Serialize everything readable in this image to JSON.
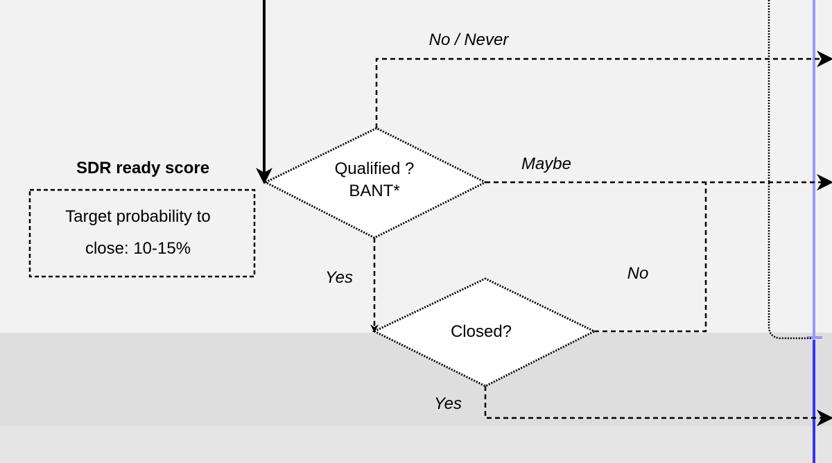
{
  "lanes": {
    "upper_color": "#f2f2f2",
    "middle_color": "#dedede",
    "lower_color": "#e5e5e5"
  },
  "boundary": {
    "upper_color": "#9999ff",
    "lower_color": "#3333ff"
  },
  "decision_qualified": {
    "line1": "Qualified ?",
    "line2": "BANT*"
  },
  "decision_closed": {
    "label": "Closed?"
  },
  "edges": {
    "no_never": "No / Never",
    "maybe": "Maybe",
    "yes_qualified": "Yes",
    "no_closed": "No",
    "yes_closed": "Yes"
  },
  "score": {
    "title": "SDR ready score",
    "line1": "Target probability to",
    "line2": "close: 10-15%"
  }
}
